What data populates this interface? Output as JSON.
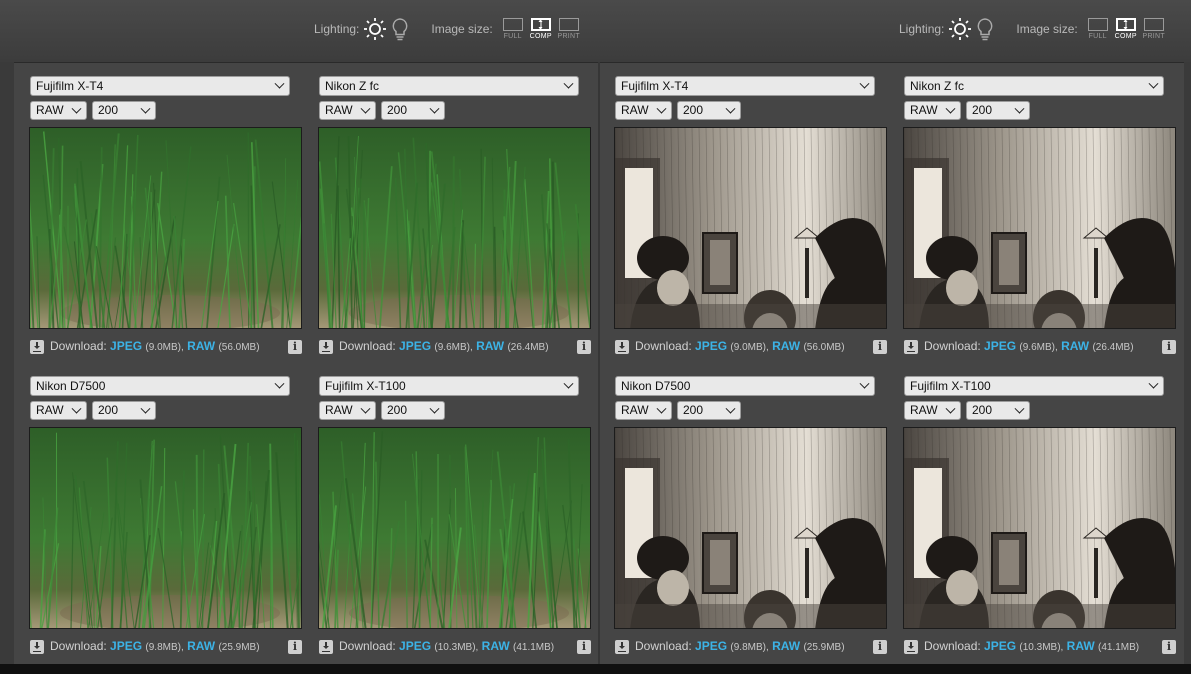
{
  "toolbar": {
    "groups": [
      {
        "lighting_label": "Lighting:",
        "image_size_label": "Image size:",
        "sizes": [
          "FULL",
          "COMP",
          "PRINT"
        ]
      },
      {
        "lighting_label": "Lighting:",
        "image_size_label": "Image size:",
        "sizes": [
          "FULL",
          "COMP",
          "PRINT"
        ]
      }
    ],
    "active_size": "COMP"
  },
  "scenes": [
    "grass",
    "engraving"
  ],
  "panels": [
    {
      "camera": "Fujifilm X-T4",
      "format": "RAW",
      "iso": "200",
      "download_label": "Download:",
      "jpeg_label": "JPEG",
      "jpeg_size": "(9.0MB),",
      "raw_label": "RAW",
      "raw_size": "(56.0MB)"
    },
    {
      "camera": "Nikon Z fc",
      "format": "RAW",
      "iso": "200",
      "download_label": "Download:",
      "jpeg_label": "JPEG",
      "jpeg_size": "(9.6MB),",
      "raw_label": "RAW",
      "raw_size": "(26.4MB)"
    },
    {
      "camera": "Fujifilm X-T4",
      "format": "RAW",
      "iso": "200",
      "download_label": "Download:",
      "jpeg_label": "JPEG",
      "jpeg_size": "(9.0MB),",
      "raw_label": "RAW",
      "raw_size": "(56.0MB)"
    },
    {
      "camera": "Nikon Z fc",
      "format": "RAW",
      "iso": "200",
      "download_label": "Download:",
      "jpeg_label": "JPEG",
      "jpeg_size": "(9.6MB),",
      "raw_label": "RAW",
      "raw_size": "(26.4MB)"
    },
    {
      "camera": "Nikon D7500",
      "format": "RAW",
      "iso": "200",
      "download_label": "Download:",
      "jpeg_label": "JPEG",
      "jpeg_size": "(9.8MB),",
      "raw_label": "RAW",
      "raw_size": "(25.9MB)"
    },
    {
      "camera": "Fujifilm X-T100",
      "format": "RAW",
      "iso": "200",
      "download_label": "Download:",
      "jpeg_label": "JPEG",
      "jpeg_size": "(10.3MB),",
      "raw_label": "RAW",
      "raw_size": "(41.1MB)"
    },
    {
      "camera": "Nikon D7500",
      "format": "RAW",
      "iso": "200",
      "download_label": "Download:",
      "jpeg_label": "JPEG",
      "jpeg_size": "(9.8MB),",
      "raw_label": "RAW",
      "raw_size": "(25.9MB)"
    },
    {
      "camera": "Fujifilm X-T100",
      "format": "RAW",
      "iso": "200",
      "download_label": "Download:",
      "jpeg_label": "JPEG",
      "jpeg_size": "(10.3MB),",
      "raw_label": "RAW",
      "raw_size": "(41.1MB)"
    }
  ],
  "colors": {
    "link": "#3cb3e6",
    "grass_dark": "#1f4a1d",
    "grass_light": "#4f8a3a",
    "engraving_paper": "#d9d2c6",
    "engraving_ink": "#2a2622"
  }
}
